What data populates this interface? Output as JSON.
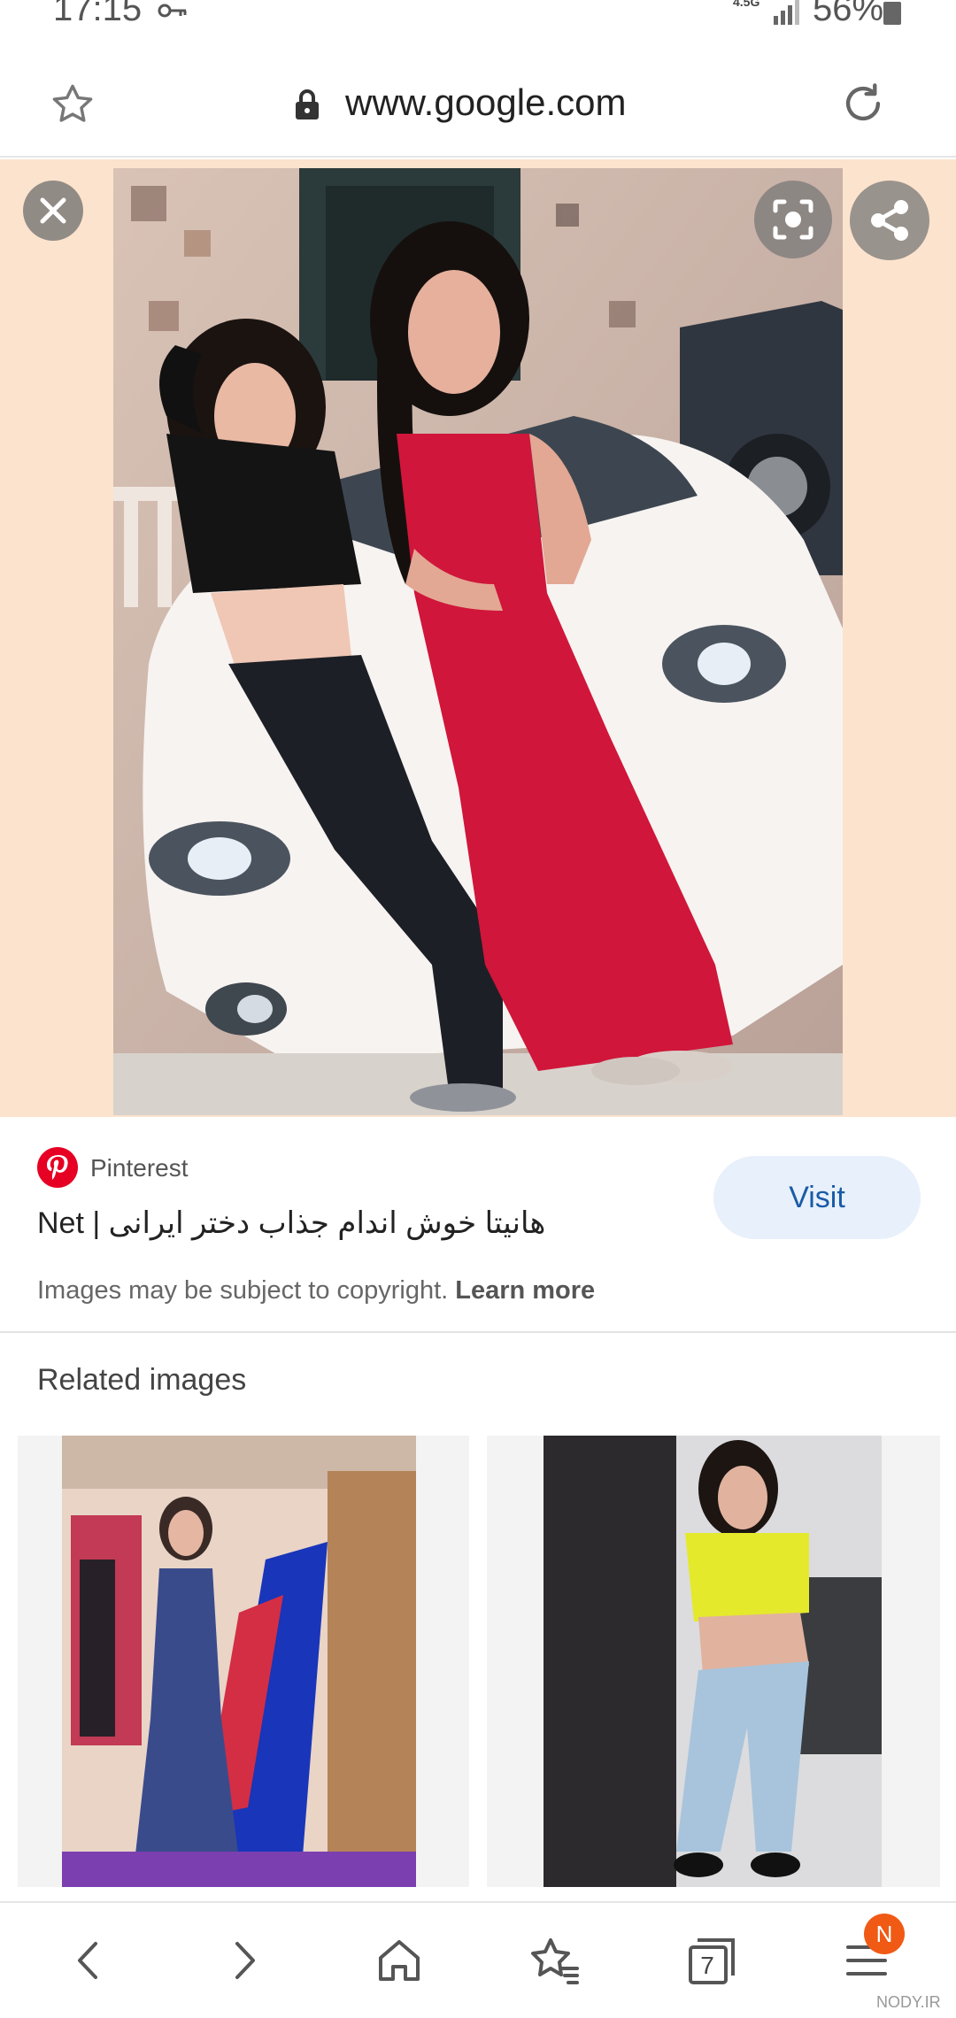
{
  "status_bar": {
    "time": "17:15",
    "network": "4.5G",
    "battery": "56%"
  },
  "url_bar": {
    "url": "www.google.com"
  },
  "source": {
    "site": "Pinterest",
    "title": "Net | هانیتا خوش اندام جذاب دختر ایرانی",
    "visit_label": "Visit",
    "copyright_text": "Images may be subject to copyright.",
    "learn_more": "Learn more"
  },
  "related": {
    "title": "Related images"
  },
  "bottom_nav": {
    "tab_count": "7",
    "badge": "N"
  },
  "watermark": "NODY.IR",
  "colors": {
    "accent": "#1a5ba6",
    "pinterest": "#e60023",
    "badge": "#f05a14",
    "viewer_bg": "#fce3cd"
  }
}
